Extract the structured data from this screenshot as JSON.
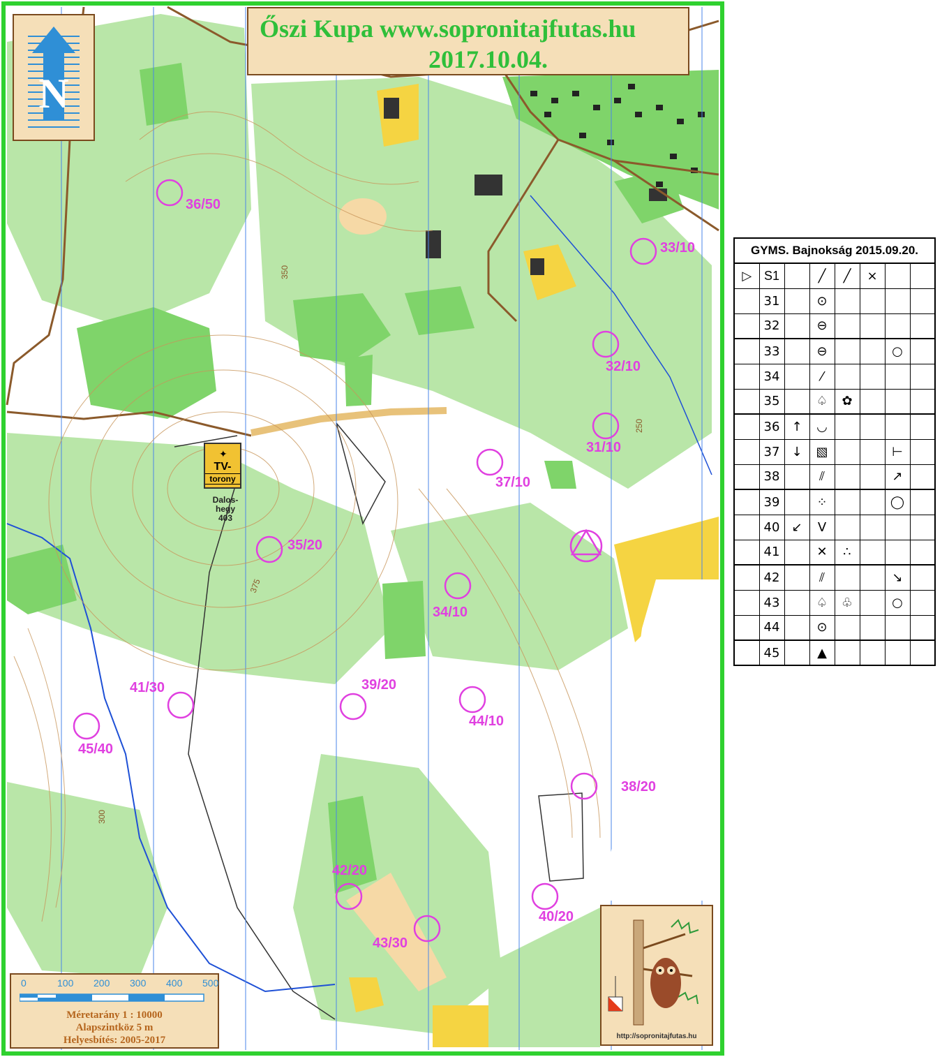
{
  "map": {
    "title_line1": "Őszi Kupa www.sopronitajfutas.hu",
    "title_line2": "2017.10.04.",
    "north_letter": "N",
    "tv_tower": {
      "line1": "TV-",
      "line2": "torony"
    },
    "hill_name": [
      "Dalos-",
      "hegy",
      "403"
    ],
    "contour_labels": [
      "350",
      "375",
      "300",
      "250"
    ],
    "scale": {
      "ticks": [
        "0",
        "100",
        "200",
        "300",
        "400",
        "500"
      ],
      "line1": "Méretarány  1 : 10000",
      "line2": "Alapszintköz  5 m",
      "line3": "Helyesbítés: 2005-2017"
    },
    "logo_url": "http://sopronitajfutas.hu",
    "colors": {
      "frame": "#2fd12f",
      "control": "#e040e0",
      "forest": "#7fd46a",
      "open": "#f5d442",
      "north_arrow": "#2f8fd6"
    },
    "controls": [
      {
        "code": "36/50"
      },
      {
        "code": "33/10"
      },
      {
        "code": "32/10"
      },
      {
        "code": "31/10"
      },
      {
        "code": "37/10"
      },
      {
        "code": "35/20"
      },
      {
        "code": "34/10"
      },
      {
        "code": "41/30"
      },
      {
        "code": "39/20"
      },
      {
        "code": "44/10"
      },
      {
        "code": "45/40"
      },
      {
        "code": "38/20"
      },
      {
        "code": "42/20"
      },
      {
        "code": "40/20"
      },
      {
        "code": "43/30"
      }
    ]
  },
  "descriptions": {
    "header": "GYMS. Bajnokság  2015.09.20.",
    "rows": [
      {
        "num": "S1",
        "cells": [
          "▷",
          "",
          "╱",
          "╱",
          "×",
          "",
          ""
        ]
      },
      {
        "num": "31",
        "cells": [
          "",
          "",
          "⊙",
          "",
          "",
          "",
          ""
        ]
      },
      {
        "num": "32",
        "cells": [
          "",
          "",
          "⊖",
          "",
          "",
          "",
          ""
        ]
      },
      {
        "num": "33",
        "cells": [
          "",
          "",
          "⊖",
          "",
          "",
          "○",
          ""
        ]
      },
      {
        "num": "34",
        "cells": [
          "",
          "",
          "⁄",
          "",
          "",
          "",
          ""
        ]
      },
      {
        "num": "35",
        "cells": [
          "",
          "",
          "♤",
          "✿",
          "",
          "",
          ""
        ]
      },
      {
        "num": "36",
        "cells": [
          "",
          "↑",
          "◡",
          "",
          "",
          "",
          ""
        ]
      },
      {
        "num": "37",
        "cells": [
          "",
          "↓",
          "▧",
          "",
          "",
          "⊢",
          ""
        ]
      },
      {
        "num": "38",
        "cells": [
          "",
          "",
          "⫽",
          "",
          "",
          "↗",
          ""
        ]
      },
      {
        "num": "39",
        "cells": [
          "",
          "",
          "⁘",
          "",
          "",
          "◯",
          ""
        ]
      },
      {
        "num": "40",
        "cells": [
          "",
          "↙",
          "V",
          "",
          "",
          "",
          ""
        ]
      },
      {
        "num": "41",
        "cells": [
          "",
          "",
          "✕",
          "∴",
          "",
          "",
          ""
        ]
      },
      {
        "num": "42",
        "cells": [
          "",
          "",
          "⫽",
          "",
          "",
          "↘",
          ""
        ]
      },
      {
        "num": "43",
        "cells": [
          "",
          "",
          "♤",
          "♧",
          "",
          "○",
          ""
        ]
      },
      {
        "num": "44",
        "cells": [
          "",
          "",
          "⊙",
          "",
          "",
          "",
          ""
        ]
      },
      {
        "num": "45",
        "cells": [
          "",
          "",
          "▲",
          "",
          "",
          "",
          ""
        ]
      }
    ]
  }
}
